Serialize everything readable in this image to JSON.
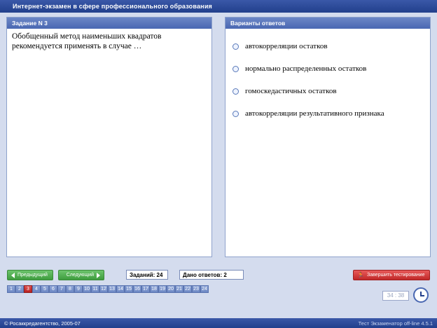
{
  "app": {
    "title": "Интернет-экзамен в сфере профессионального образования"
  },
  "question_panel": {
    "header": "Задание N 3",
    "text": "Обобщенный метод наименьших квадратов рекомендуется применять в случае …"
  },
  "answers_panel": {
    "header": "Варианты ответов",
    "options": [
      "автокорреляции остатков",
      "нормально распределенных остатков",
      "гомоскедастичных остатков",
      "автокорреляции результативного признака"
    ]
  },
  "toolbar": {
    "prev_label": "Предыдущий",
    "next_label": "Следующий",
    "total_tasks": "Заданий: 24",
    "answers_given": "Дано ответов: 2",
    "finish_label": "Завершить тестирование"
  },
  "task_numbers": [
    "1",
    "2",
    "3",
    "4",
    "5",
    "6",
    "7",
    "8",
    "9",
    "10",
    "11",
    "12",
    "13",
    "14",
    "15",
    "16",
    "17",
    "18",
    "19",
    "20",
    "21",
    "22",
    "23",
    "24"
  ],
  "current_task": "3",
  "timer": "34 : 38",
  "footer": {
    "left": "© Росаккредагентство, 2005-07",
    "right": "Тест Экзаменатор off-line 4.5.1"
  },
  "colors": {
    "title_bar": "#22408c",
    "panel_header": "#4a68b2",
    "nav_button": "#3e9c3e",
    "finish_button": "#c02828",
    "current_task": "#b82020"
  }
}
